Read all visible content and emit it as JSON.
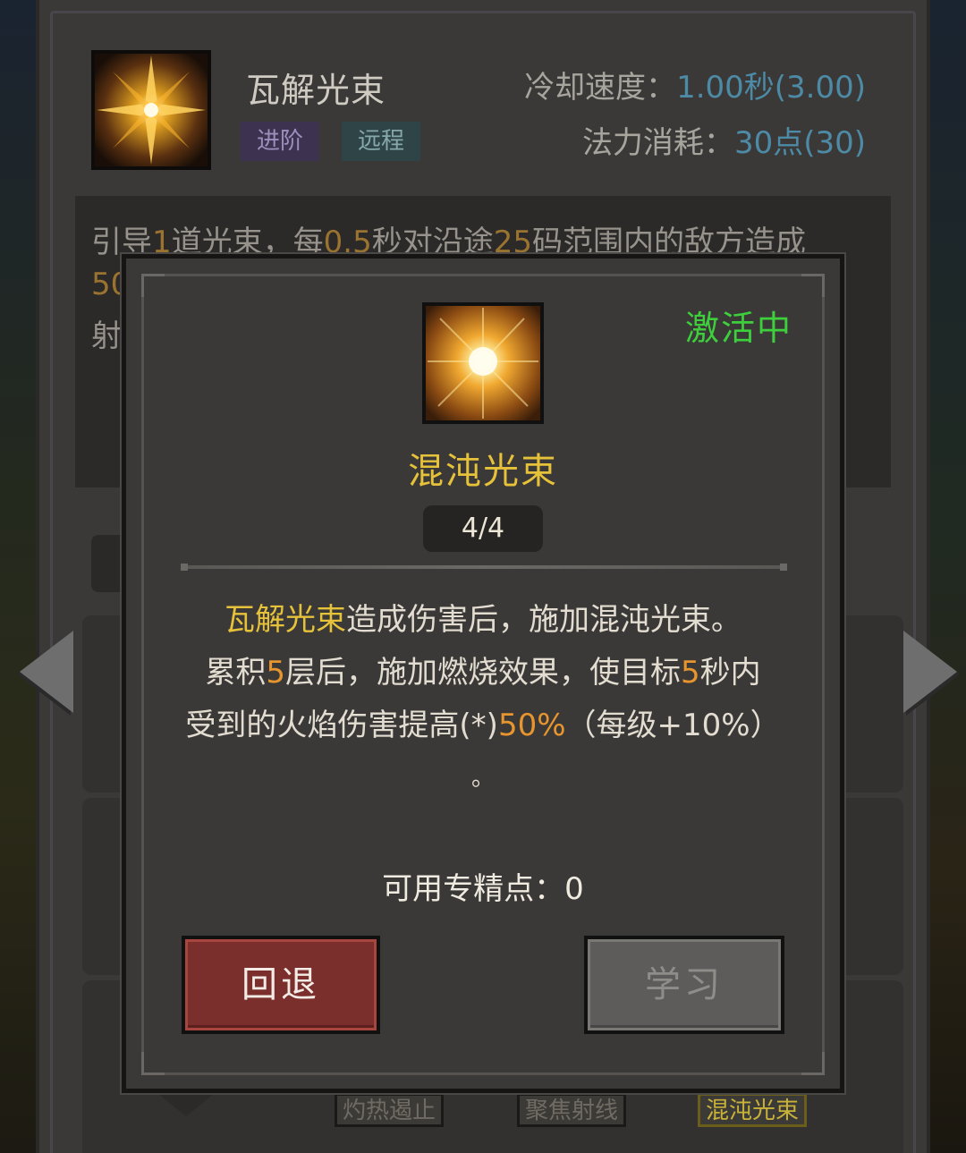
{
  "skill": {
    "name": "瓦解光束",
    "tags": [
      "进阶",
      "远程"
    ],
    "cooldown": {
      "label": "冷却速度：",
      "value": "1.00秒",
      "base": "(3.00)"
    },
    "mana": {
      "label": "法力消耗：",
      "value": "30点",
      "base": "(30)"
    },
    "description": {
      "line1_parts": [
        "引导",
        "1",
        "道光束，每",
        "0.5",
        "秒对沿途",
        "25",
        "码范围内的敌方造成"
      ],
      "line2_start": "50",
      "line3_start": "射"
    }
  },
  "bottom_tabs": [
    "灼热遏止",
    "聚焦射线",
    "混沌光束"
  ],
  "modal": {
    "status": "激活中",
    "talent_name": "混沌光束",
    "rank": "4/4",
    "desc": {
      "l1_highlight": "瓦解光束",
      "l1_rest": "造成伤害后，施加混沌光束。",
      "l2_a": "累积",
      "l2_b": "5",
      "l2_c": "层后，施加燃烧效果，使目标",
      "l2_d": "5",
      "l2_e": "秒内",
      "l3_a": "受到的火焰伤害提高(*)",
      "l3_b": "50%",
      "l3_c": "（每级+10%）",
      "l4": "。"
    },
    "points_label": "可用专精点：",
    "points_value": "0",
    "back_label": "回退",
    "learn_label": "学习"
  },
  "colors": {
    "active_green": "#3ecf3c",
    "talent_gold": "#e6c23a",
    "value_orange": "#e7952e",
    "stat_blue": "#4d8aa6",
    "back_red": "#7a2f2c"
  },
  "icons": [
    "starburst-skill-icon",
    "radiant-sun-talent-icon",
    "arrow-left-icon",
    "arrow-right-icon",
    "chevron-down-icon"
  ]
}
